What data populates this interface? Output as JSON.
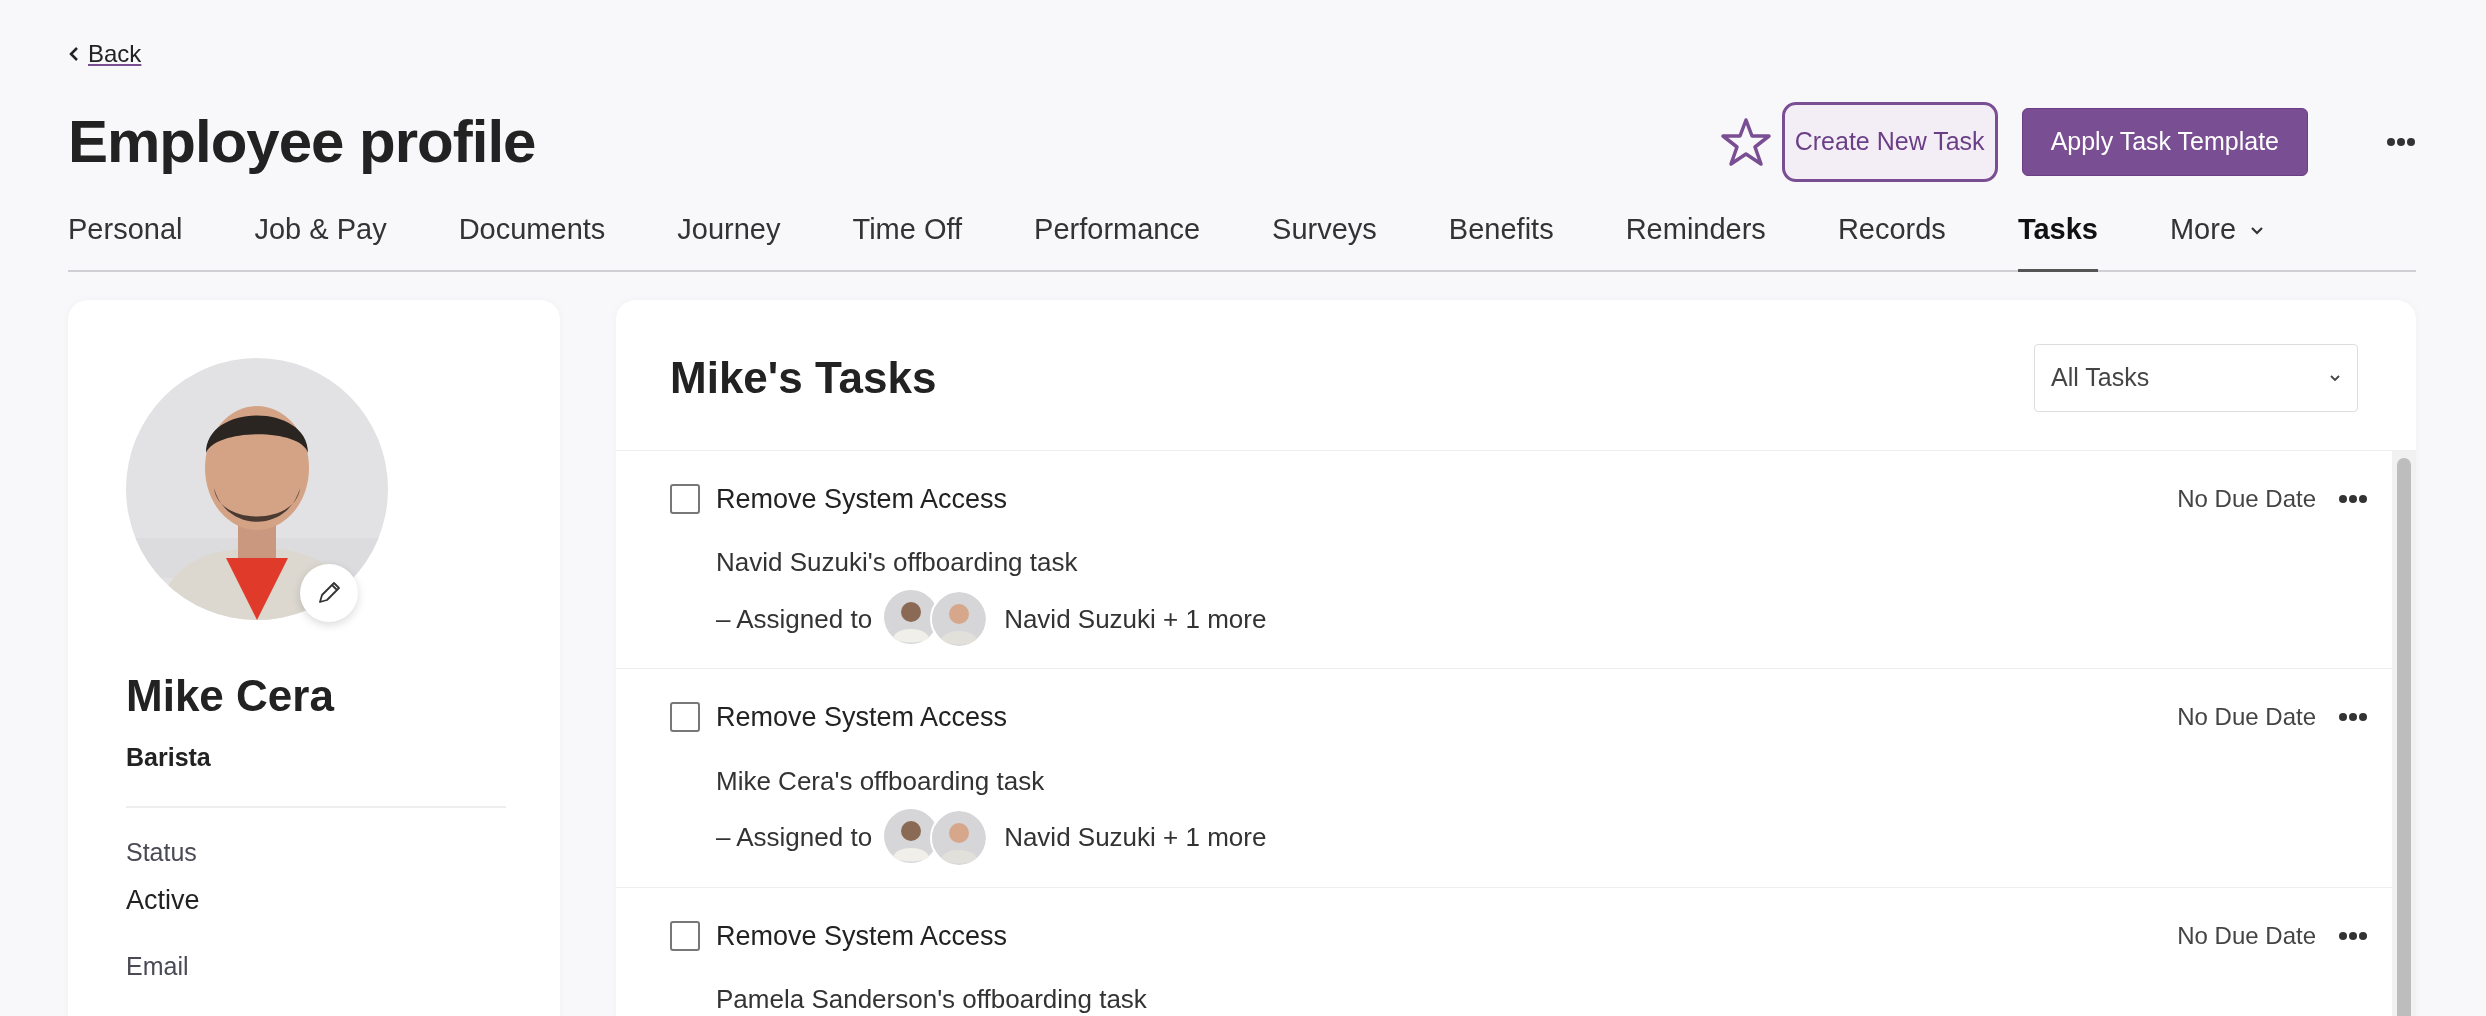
{
  "back_link": "Back",
  "title": "Employee profile",
  "favorite": false,
  "buttons": [
    {
      "label": "Create New Task",
      "kind": "outline"
    },
    {
      "label": "Apply Task Template",
      "kind": "primary"
    }
  ],
  "tabs": [
    {
      "label": "Personal",
      "selected": false
    },
    {
      "label": "Job & Pay",
      "selected": false
    },
    {
      "label": "Documents",
      "selected": false
    },
    {
      "label": "Journey",
      "selected": false
    },
    {
      "label": "Time Off",
      "selected": false
    },
    {
      "label": "Performance",
      "selected": false
    },
    {
      "label": "Surveys",
      "selected": false
    },
    {
      "label": "Benefits",
      "selected": false
    },
    {
      "label": "Reminders",
      "selected": false
    },
    {
      "label": "Records",
      "selected": false
    },
    {
      "label": "Tasks",
      "selected": true
    },
    {
      "label": "More",
      "selected": false,
      "kind": "dropdown"
    }
  ],
  "profile": {
    "name": "Mike Cera",
    "job_title": "Barista",
    "fields": [
      {
        "label": "Status",
        "value": "Active"
      },
      {
        "label": "Email"
      }
    ]
  },
  "tasks": {
    "title": "Mike's Tasks",
    "filter": "All Tasks",
    "items": [
      {
        "title": "Remove System Access",
        "checked": false,
        "due": "No Due Date",
        "subtitle": "Navid Suzuki's offboarding task",
        "assigned_label": "– Assigned to",
        "assignees": "Navid Suzuki + 1 more"
      },
      {
        "title": "Remove System Access",
        "checked": false,
        "due": "No Due Date",
        "subtitle": "Mike Cera's offboarding task",
        "assigned_label": "– Assigned to",
        "assignees": "Navid Suzuki + 1 more"
      },
      {
        "title": "Remove System Access",
        "checked": false,
        "due": "No Due Date",
        "subtitle": "Pamela Sanderson's offboarding task"
      }
    ]
  }
}
